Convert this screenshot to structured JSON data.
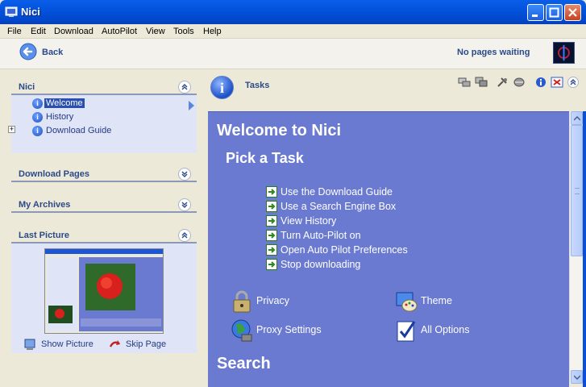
{
  "window": {
    "title": "Nici"
  },
  "menu": [
    "File",
    "Edit",
    "Download",
    "AutoPilot",
    "View",
    "Tools",
    "Help"
  ],
  "toolbar": {
    "back_label": "Back",
    "status": "No pages waiting"
  },
  "sidebar": {
    "nici": {
      "title": "Nici",
      "items": [
        {
          "label": "Welcome",
          "selected": true
        },
        {
          "label": "History"
        },
        {
          "label": "Download Guide"
        }
      ]
    },
    "download_pages": {
      "title": "Download Pages"
    },
    "my_archives": {
      "title": "My Archives"
    },
    "last_picture": {
      "title": "Last Picture",
      "show_picture": "Show Picture",
      "skip_page": "Skip Page"
    }
  },
  "tasks_header": {
    "label": "Tasks"
  },
  "main": {
    "welcome_title": "Welcome to Nici",
    "pick_title": "Pick a Task",
    "tasks": [
      "Use the Download Guide",
      "Use a Search Engine Box",
      "View History",
      "Turn Auto-Pilot on",
      "Open Auto Pilot Preferences",
      "Stop downloading"
    ],
    "options": [
      {
        "label": "Privacy",
        "icon": "lock-icon"
      },
      {
        "label": "Theme",
        "icon": "theme-icon"
      },
      {
        "label": "Proxy Settings",
        "icon": "globe-icon"
      },
      {
        "label": "All Options",
        "icon": "checklist-icon"
      }
    ],
    "search_title": "Search"
  },
  "colors": {
    "content_bg": "#6a7ad0",
    "accent": "#2b4a8a",
    "titlebar": "#0453dd"
  }
}
